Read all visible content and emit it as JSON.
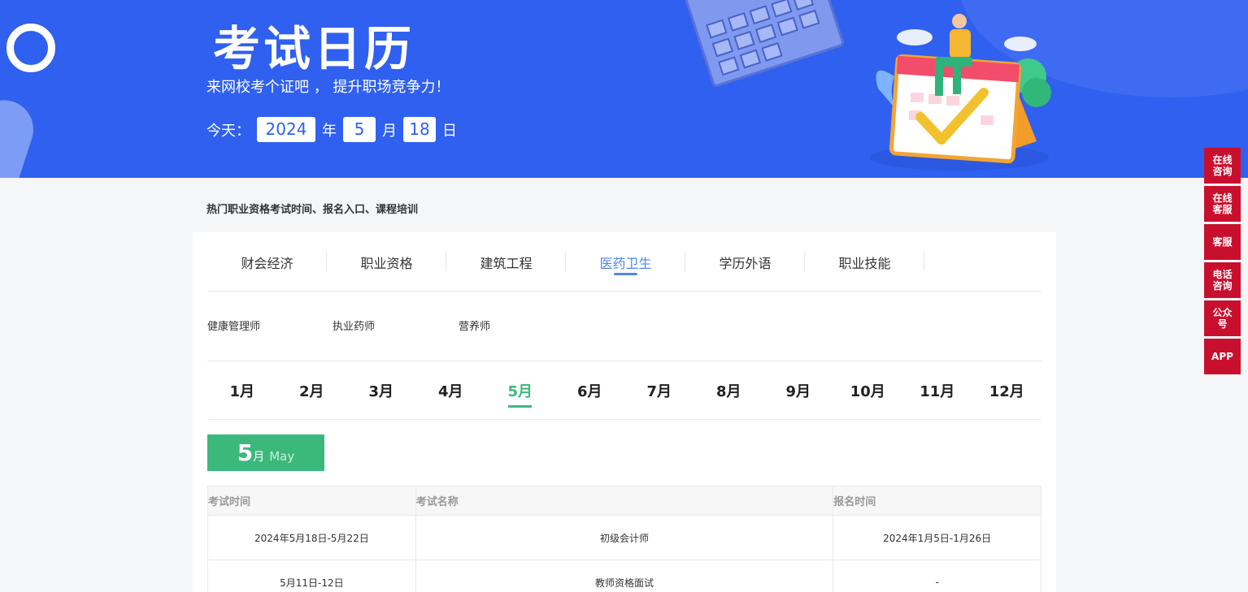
{
  "banner": {
    "title": "考试日历",
    "subtitle": "来网校考个证吧 ， 提升职场竞争力！",
    "today_label": "今天：",
    "year": "2024",
    "year_unit": "年",
    "month": "5",
    "month_unit": "月",
    "day": "18",
    "day_unit": "日"
  },
  "side_buttons": [
    "在线咨询",
    "在线客服",
    "客服",
    "电话咨询",
    "公众号",
    "APP"
  ],
  "lead_text": "热门职业资格考试时间、报名入口、课程培训",
  "categories": [
    "财会经济",
    "职业资格",
    "建筑工程",
    "医药卫生",
    "学历外语",
    "职业技能"
  ],
  "active_category": "医药卫生",
  "subcategories": [
    "健康管理师",
    "执业药师",
    "营养师"
  ],
  "months": [
    "1月",
    "2月",
    "3月",
    "4月",
    "5月",
    "6月",
    "7月",
    "8月",
    "9月",
    "10月",
    "11月",
    "12月"
  ],
  "active_month": "5月",
  "month_badge": {
    "num": "5",
    "unit": "月",
    "en": "May"
  },
  "table": {
    "headers": [
      "考试时间",
      "考试名称",
      "报名时间"
    ],
    "rows": [
      [
        "2024年5月18日-5月22日",
        "初级会计师",
        "2024年1月5日-1月26日"
      ],
      [
        "5月11日-12日",
        "教师资格面试",
        "-"
      ]
    ]
  },
  "colors": {
    "banner": "#3060ef",
    "accent_blue": "#4f86e8",
    "accent_green": "#3bb97c",
    "side_red": "#c8102e"
  }
}
